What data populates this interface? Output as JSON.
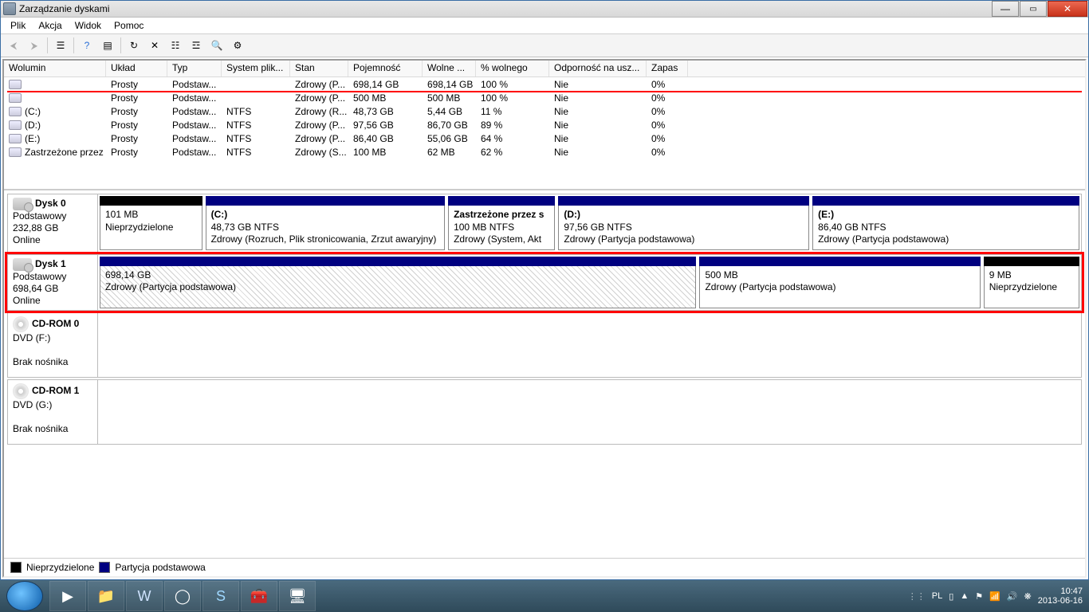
{
  "window": {
    "title": "Zarządzanie dyskami"
  },
  "menu": {
    "file": "Plik",
    "action": "Akcja",
    "view": "Widok",
    "help": "Pomoc"
  },
  "columns": {
    "volume": "Wolumin",
    "layout": "Układ",
    "type": "Typ",
    "fs": "System plik...",
    "status": "Stan",
    "capacity": "Pojemność",
    "free": "Wolne ...",
    "pctfree": "% wolnego",
    "fault": "Odporność na usz...",
    "overhead": "Zapas"
  },
  "colWidths": {
    "volume": 128,
    "layout": 77,
    "type": 68,
    "fs": 86,
    "status": 73,
    "capacity": 93,
    "free": 67,
    "pctfree": 92,
    "fault": 122,
    "overhead": 52
  },
  "volumes": [
    {
      "volume": "",
      "layout": "Prosty",
      "type": "Podstaw...",
      "fs": "",
      "status": "Zdrowy (P...",
      "capacity": "698,14 GB",
      "free": "698,14 GB",
      "pctfree": "100 %",
      "fault": "Nie",
      "overhead": "0%"
    },
    {
      "volume": "",
      "layout": "Prosty",
      "type": "Podstaw...",
      "fs": "",
      "status": "Zdrowy (P...",
      "capacity": "500 MB",
      "free": "500 MB",
      "pctfree": "100 %",
      "fault": "Nie",
      "overhead": "0%"
    },
    {
      "volume": "(C:)",
      "layout": "Prosty",
      "type": "Podstaw...",
      "fs": "NTFS",
      "status": "Zdrowy (R...",
      "capacity": "48,73 GB",
      "free": "5,44 GB",
      "pctfree": "11 %",
      "fault": "Nie",
      "overhead": "0%"
    },
    {
      "volume": "(D:)",
      "layout": "Prosty",
      "type": "Podstaw...",
      "fs": "NTFS",
      "status": "Zdrowy (P...",
      "capacity": "97,56 GB",
      "free": "86,70 GB",
      "pctfree": "89 %",
      "fault": "Nie",
      "overhead": "0%"
    },
    {
      "volume": "(E:)",
      "layout": "Prosty",
      "type": "Podstaw...",
      "fs": "NTFS",
      "status": "Zdrowy (P...",
      "capacity": "86,40 GB",
      "free": "55,06 GB",
      "pctfree": "64 %",
      "fault": "Nie",
      "overhead": "0%"
    },
    {
      "volume": "Zastrzeżone przez ...",
      "layout": "Prosty",
      "type": "Podstaw...",
      "fs": "NTFS",
      "status": "Zdrowy (S...",
      "capacity": "100 MB",
      "free": "62 MB",
      "pctfree": "62 %",
      "fault": "Nie",
      "overhead": "0%"
    }
  ],
  "disks": [
    {
      "name": "Dysk 0",
      "type": "Podstawowy",
      "size": "232,88 GB",
      "status": "Online",
      "highlight": false,
      "parts": [
        {
          "label": "",
          "line2": "101 MB",
          "line3": "Nieprzydzielone",
          "cap": "black",
          "flex": 40,
          "hatch": false
        },
        {
          "label": "(C:)",
          "line2": "48,73 GB NTFS",
          "line3": "Zdrowy (Rozruch, Plik stronicowania, Zrzut awaryjny)",
          "cap": "navy",
          "flex": 100,
          "hatch": false
        },
        {
          "label": "Zastrzeżone przez s",
          "line2": "100 MB NTFS",
          "line3": "Zdrowy (System, Akt",
          "cap": "navy",
          "flex": 42,
          "hatch": false
        },
        {
          "label": "(D:)",
          "line2": "97,56 GB NTFS",
          "line3": "Zdrowy (Partycja podstawowa)",
          "cap": "navy",
          "flex": 105,
          "hatch": false
        },
        {
          "label": "(E:)",
          "line2": "86,40 GB NTFS",
          "line3": "Zdrowy (Partycja podstawowa)",
          "cap": "navy",
          "flex": 112,
          "hatch": false
        }
      ]
    },
    {
      "name": "Dysk 1",
      "type": "Podstawowy",
      "size": "698,64 GB",
      "status": "Online",
      "highlight": true,
      "parts": [
        {
          "label": "",
          "line2": "698,14 GB",
          "line3": "Zdrowy (Partycja podstawowa)",
          "cap": "navy",
          "flex": 760,
          "hatch": true
        },
        {
          "label": "",
          "line2": "500 MB",
          "line3": "Zdrowy (Partycja podstawowa)",
          "cap": "navy",
          "flex": 350,
          "hatch": false
        },
        {
          "label": "",
          "line2": "9 MB",
          "line3": "Nieprzydzielone",
          "cap": "black",
          "flex": 110,
          "hatch": false
        }
      ]
    },
    {
      "name": "CD-ROM 0",
      "type": "DVD (F:)",
      "size": "",
      "status": "Brak nośnika",
      "highlight": false,
      "optical": true,
      "parts": []
    },
    {
      "name": "CD-ROM 1",
      "type": "DVD (G:)",
      "size": "",
      "status": "Brak nośnika",
      "highlight": false,
      "optical": true,
      "parts": []
    }
  ],
  "legend": {
    "unalloc": "Nieprzydzielone",
    "primary": "Partycja podstawowa"
  },
  "tray": {
    "lang": "PL",
    "time": "10:47",
    "date": "2013-06-16"
  }
}
